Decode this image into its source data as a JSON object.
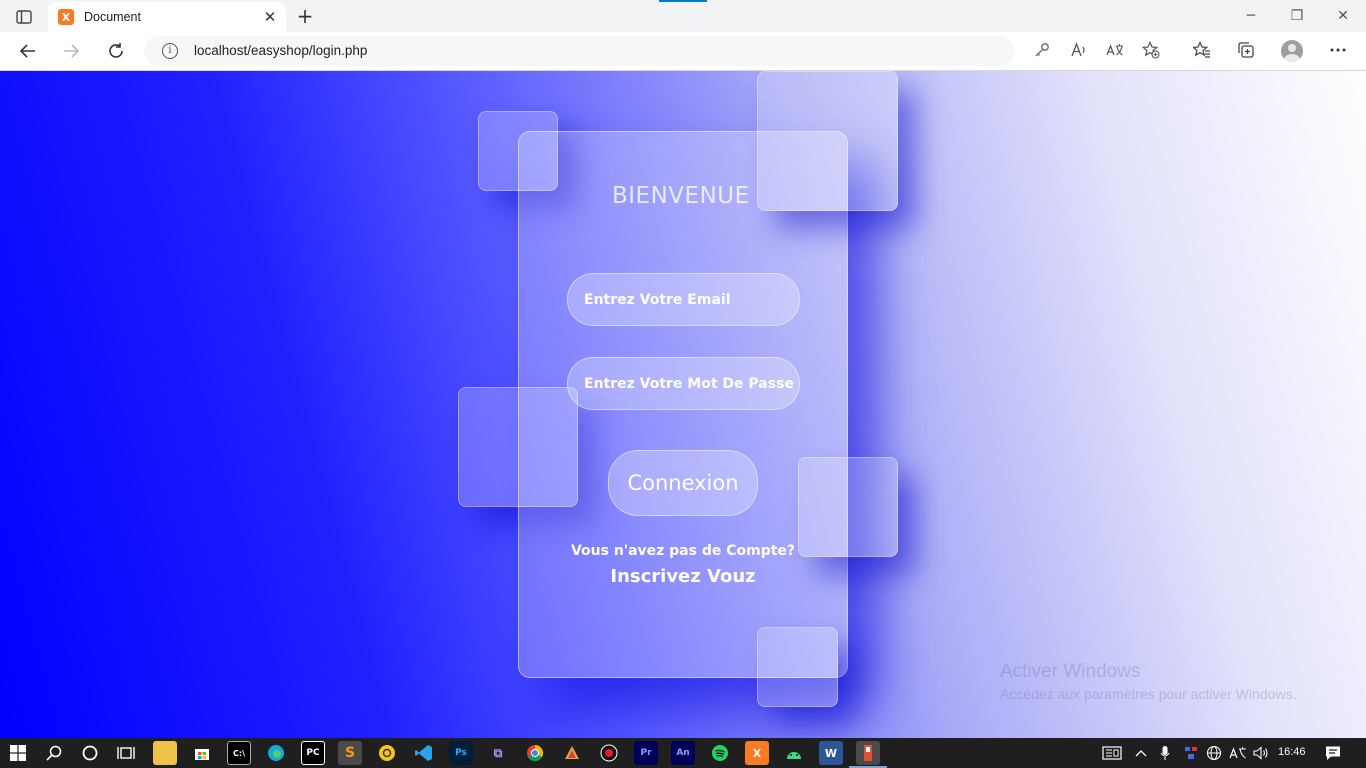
{
  "browser": {
    "tab_title": "Document",
    "favicon_letter": "X",
    "url": "localhost/easyshop/login.php",
    "new_tab_label": "+"
  },
  "page": {
    "heading": "BIENVENUE",
    "email_placeholder": "Entrez Votre Email",
    "password_placeholder": "Entrez Votre Mot De Passe",
    "login_button": "Connexion",
    "no_account_text": "Vous n'avez pas de Compte?",
    "signup_link": "Inscrivez Vouz"
  },
  "watermark": {
    "title": "Activer Windows",
    "subtitle": "Accédez aux paramètres pour activer Windows."
  },
  "taskbar": {
    "clock": "16:46",
    "apps": [
      "file-explorer-icon",
      "store-icon",
      "cmd-icon",
      "edge-icon",
      "pycharm-icon",
      "sublime-icon",
      "postman-icon",
      "vscode-icon",
      "photoshop-icon",
      "visual-studio-icon",
      "chrome-icon",
      "git-icon",
      "recorder-icon",
      "premiere-icon",
      "animate-icon",
      "spotify-icon",
      "xampp-icon",
      "android-studio-icon",
      "word-icon",
      "flash-icon"
    ]
  },
  "colors": {
    "gradient_start": "#0000ff",
    "gradient_end": "#ffffff",
    "text": "#ffffff"
  }
}
